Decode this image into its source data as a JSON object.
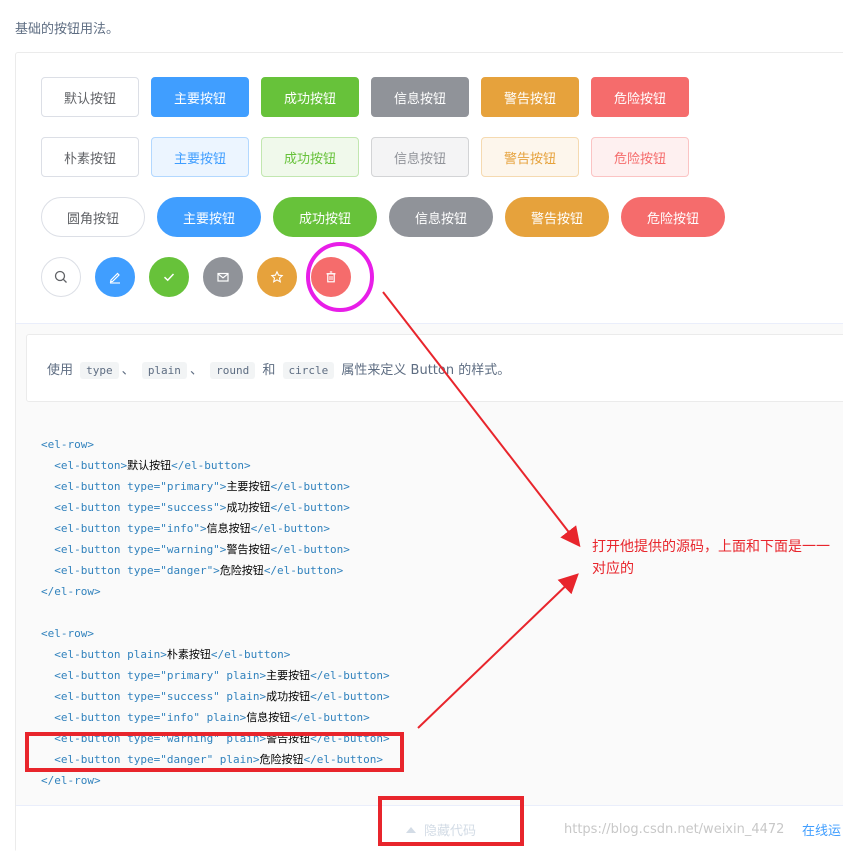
{
  "intro": "基础的按钮用法。",
  "rows": {
    "default": [
      "默认按钮",
      "主要按钮",
      "成功按钮",
      "信息按钮",
      "警告按钮",
      "危险按钮"
    ],
    "plain": [
      "朴素按钮",
      "主要按钮",
      "成功按钮",
      "信息按钮",
      "警告按钮",
      "危险按钮"
    ],
    "round": [
      "圆角按钮",
      "主要按钮",
      "成功按钮",
      "信息按钮",
      "警告按钮",
      "危险按钮"
    ]
  },
  "circle_icons": [
    "search-icon",
    "edit-icon",
    "check-icon",
    "message-icon",
    "star-icon",
    "delete-icon"
  ],
  "description": {
    "prefix": "使用",
    "code1": "type",
    "sep1": "、",
    "code2": "plain",
    "sep2": "、",
    "code3": "round",
    "and": "和",
    "code4": "circle",
    "suffix": "属性来定义 Button 的样式。"
  },
  "code_lines": [
    "<el-row>",
    "  <el-button>默认按钮</el-button>",
    "  <el-button type=\"primary\">主要按钮</el-button>",
    "  <el-button type=\"success\">成功按钮</el-button>",
    "  <el-button type=\"info\">信息按钮</el-button>",
    "  <el-button type=\"warning\">警告按钮</el-button>",
    "  <el-button type=\"danger\">危险按钮</el-button>",
    "</el-row>",
    "",
    "<el-row>",
    "  <el-button plain>朴素按钮</el-button>",
    "  <el-button type=\"primary\" plain>主要按钮</el-button>",
    "  <el-button type=\"success\" plain>成功按钮</el-button>",
    "  <el-button type=\"info\" plain>信息按钮</el-button>",
    "  <el-button type=\"warning\" plain>警告按钮</el-button>",
    "  <el-button type=\"danger\" plain>危险按钮</el-button>",
    "</el-row>"
  ],
  "control": {
    "hide_code": "隐藏代码",
    "online": "在线运",
    "watermark": "https://blog.csdn.net/weixin_4472"
  },
  "annotation": "打开他提供的源码，上面和下面是一一对应的",
  "colors": {
    "primary": "#409eff",
    "success": "#67c23a",
    "info": "#909399",
    "warning": "#e6a23c",
    "danger": "#f56c6c",
    "annotation": "#e8252c",
    "highlight_circle": "#e81ee8"
  }
}
